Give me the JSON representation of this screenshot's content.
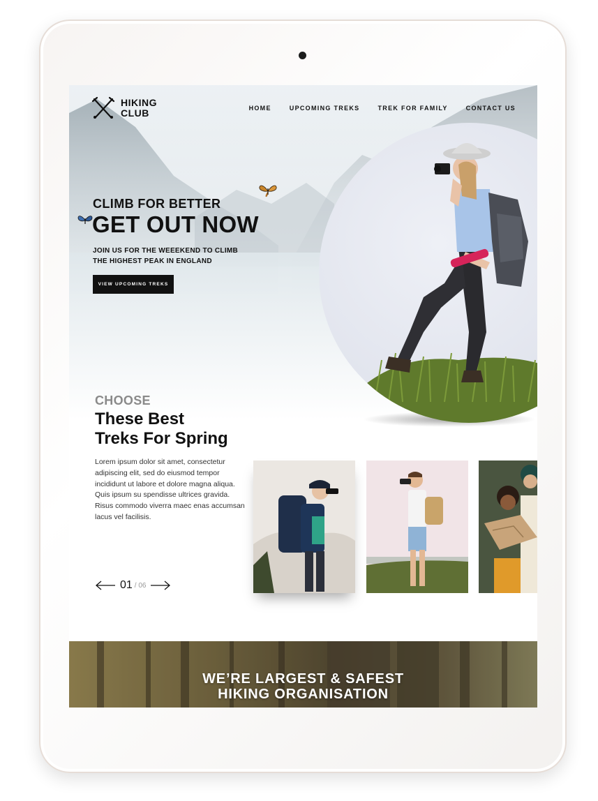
{
  "logo": {
    "line1": "HIKING",
    "line2": "CLUB"
  },
  "nav": {
    "items": [
      {
        "label": "HOME"
      },
      {
        "label": "UPCOMING TREKS"
      },
      {
        "label": "TREK FOR FAMILY"
      },
      {
        "label": "CONTACT US"
      }
    ]
  },
  "hero": {
    "kicker": "CLIMB FOR BETTER",
    "title": "GET OUT NOW",
    "subtitle": "JOIN US FOR THE WEEEKEND TO CLIMB THE HIGHEST PEAK IN ENGLAND",
    "button_label": "VIEW UPCOMING TREKS"
  },
  "choose": {
    "kicker": "CHOOSE",
    "title_line1": "These Best",
    "title_line2": "Treks For Spring",
    "body": "Lorem ipsum dolor sit amet, consectetur adipiscing elit, sed do eiusmod tempor incididunt ut labore et dolore magna aliqua. Quis ipsum su spendisse ultrices gravida. Risus commodo viverra maec enas accumsan lacus vel facilisis."
  },
  "pager": {
    "current": "01",
    "total": "/ 06"
  },
  "banner": {
    "line1": "WE’RE LARGEST & SAFEST",
    "line2": "HIKING ORGANISATION"
  },
  "colors": {
    "dark": "#111111",
    "muted": "#8a8a8a",
    "accent_bottle": "#d6245a"
  }
}
